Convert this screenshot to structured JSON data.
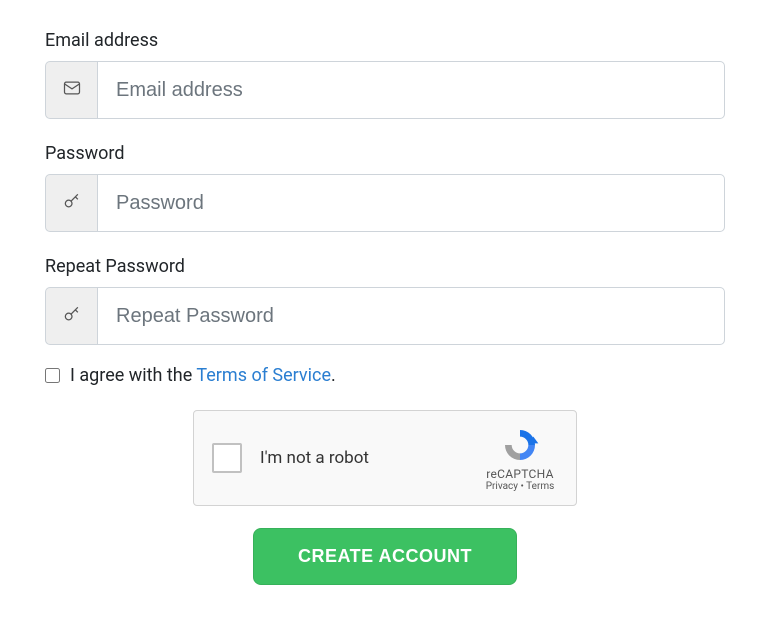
{
  "email": {
    "label": "Email address",
    "placeholder": "Email address"
  },
  "password": {
    "label": "Password",
    "placeholder": "Password"
  },
  "repeat_password": {
    "label": "Repeat Password",
    "placeholder": "Repeat Password"
  },
  "agree": {
    "text_before": "I agree with the ",
    "link_text": "Terms of Service",
    "text_after": "."
  },
  "recaptcha": {
    "label": "I'm not a robot",
    "brand": "reCAPTCHA",
    "privacy": "Privacy",
    "separator": " • ",
    "terms": "Terms"
  },
  "submit": {
    "label": "CREATE ACCOUNT"
  },
  "colors": {
    "accent_button": "#3cc162",
    "link": "#2a7ed1"
  }
}
